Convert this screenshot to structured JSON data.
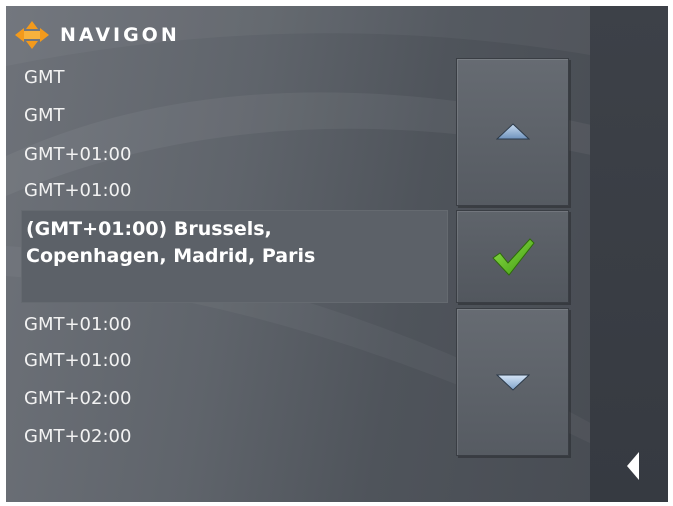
{
  "app": {
    "brand": "NAVIGON"
  },
  "list": {
    "items_above": [
      "GMT",
      "GMT",
      "GMT+01:00",
      "GMT+01:00"
    ],
    "selected": {
      "line1": "(GMT+01:00) Brussels,",
      "line2": "Copenhagen, Madrid, Paris"
    },
    "items_below": [
      "GMT+01:00",
      "GMT+01:00",
      "GMT+02:00",
      "GMT+02:00"
    ]
  },
  "buttons": {
    "scroll_up": "triangle-up-icon",
    "confirm": "checkmark-icon",
    "scroll_down": "triangle-down-icon",
    "back": "triangle-left-icon"
  },
  "colors": {
    "logo_orange": "#f39a1c",
    "check_green": "#5cc01a",
    "selected_row": "#5c6168",
    "text": "#f2f2f2"
  }
}
